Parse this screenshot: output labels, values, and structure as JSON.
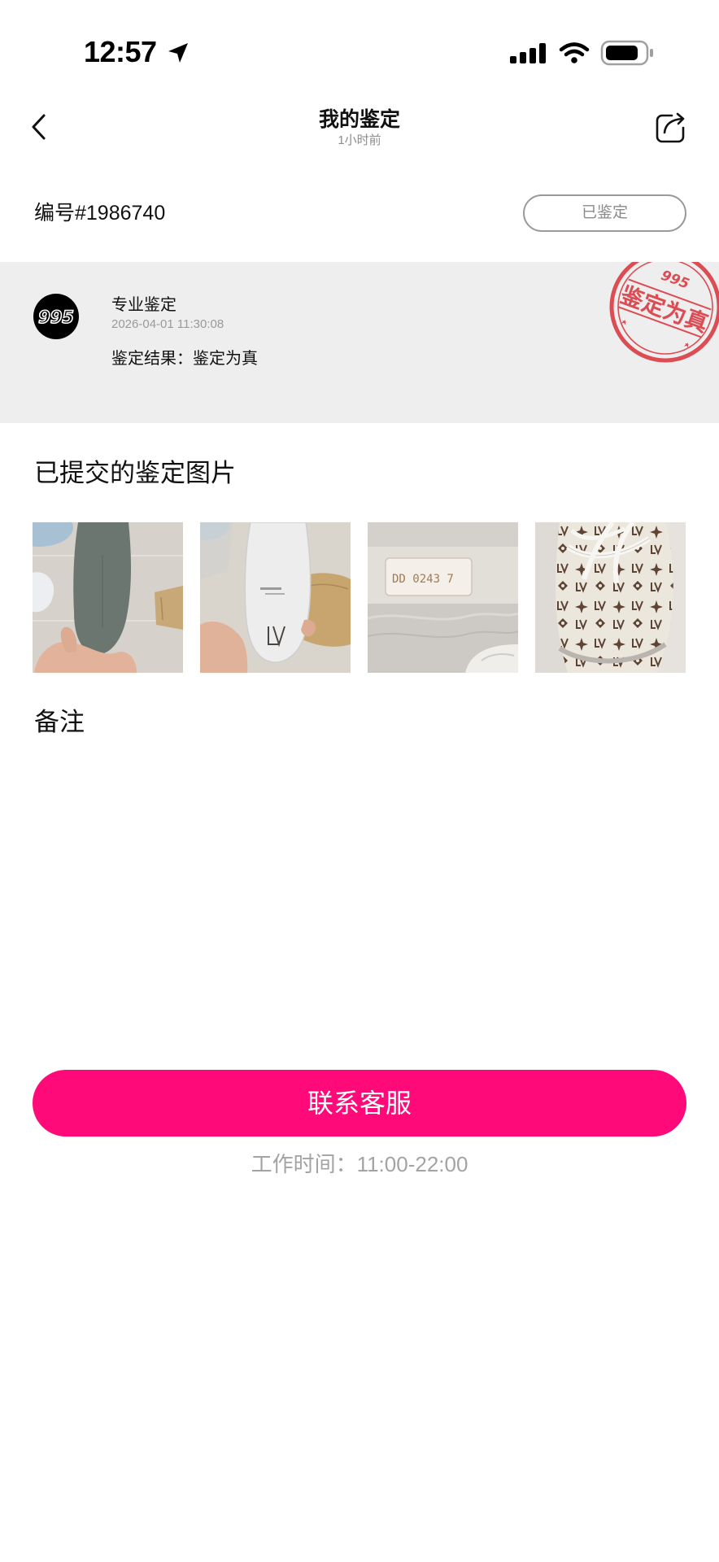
{
  "status_bar": {
    "time": "12:57",
    "icons": [
      "location-arrow-icon",
      "signal-icon",
      "wifi-icon",
      "battery-icon"
    ]
  },
  "header": {
    "title": "我的鉴定",
    "subtitle": "1小时前",
    "back_icon": "chevron-left-icon",
    "share_icon": "share-icon"
  },
  "record": {
    "number": "编号#1986740",
    "status_label": "已鉴定"
  },
  "result": {
    "logo_text": "995",
    "type": "专业鉴定",
    "datetime": "2026-04-01 11:30:08",
    "result_text": "鉴定结果：鉴定为真",
    "stamp": {
      "brand": "995",
      "text": "鉴定为真"
    }
  },
  "photos": {
    "title": "已提交的鉴定图片",
    "label_text": "DD 0243  7"
  },
  "notes": {
    "title": "备注"
  },
  "support": {
    "button_label": "联系客服",
    "hours": "工作时间：11:00-22:00"
  },
  "colors": {
    "accent": "#ff0a78",
    "stamp_red": "#d9363e",
    "band_background": "#eeeeee",
    "muted_text": "#9a9a9a"
  }
}
